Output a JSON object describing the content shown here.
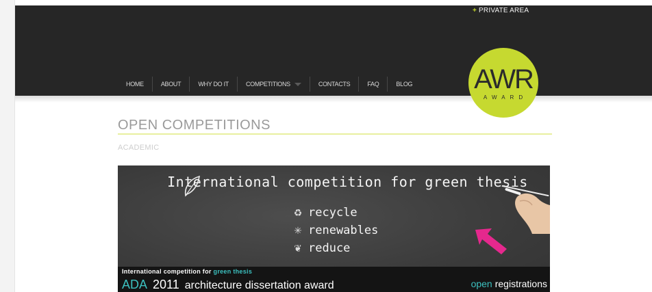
{
  "header": {
    "private_area": "PRIVATE AREA",
    "nav": [
      "HOME",
      "ABOUT",
      "WHY DO IT",
      "COMPETITIONS",
      "CONTACTS",
      "FAQ",
      "BLOG"
    ]
  },
  "logo": {
    "main": "AWR",
    "sub": "AWARD"
  },
  "page": {
    "title": "OPEN COMPETITIONS",
    "section": "ACADEMIC"
  },
  "banner": {
    "headline": "International competition for green thesis",
    "items": [
      {
        "icon": "recycle-icon",
        "label": "recycle"
      },
      {
        "icon": "wind-turbine-icon",
        "label": "renewables"
      },
      {
        "icon": "reduce-icon",
        "label": "reduce"
      }
    ],
    "strip_top_a": "International competition for",
    "strip_top_b": "green thesis",
    "strip_ada": "ADA",
    "strip_year": "2011",
    "strip_text": "architecture dissertation award",
    "strip_open": "open",
    "strip_reg": "registrations"
  },
  "colors": {
    "accent_green": "#c6d930",
    "accent_teal": "#3cc0bf",
    "arrow_pink": "#e5288d",
    "header_bg": "#262626"
  }
}
